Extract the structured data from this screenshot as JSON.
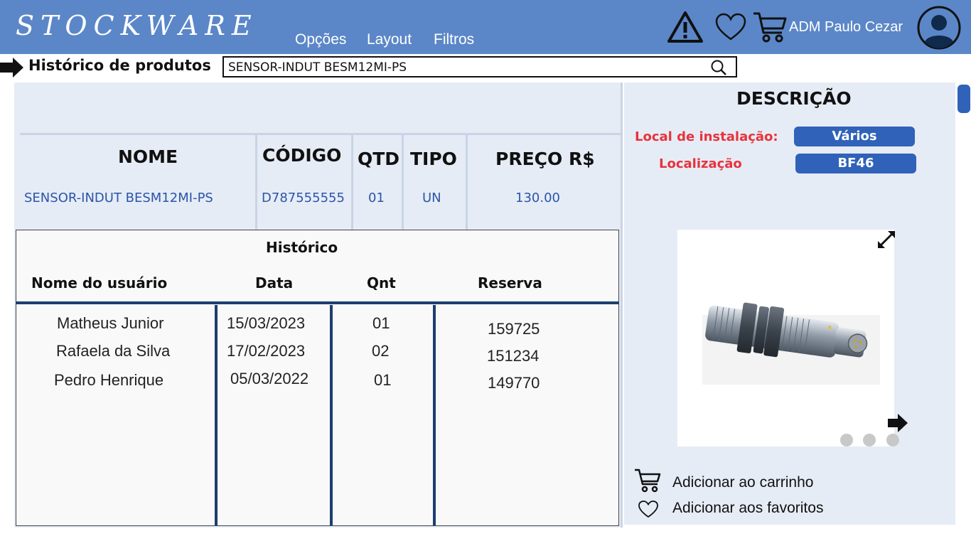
{
  "header": {
    "brand": "STOCKWARE",
    "nav": [
      "Opções",
      "Layout",
      "Filtros"
    ],
    "user_name": "ADM Paulo Cezar",
    "icons": [
      "warning-icon",
      "heart-icon",
      "cart-icon",
      "user-avatar-icon"
    ]
  },
  "search": {
    "label": "Histórico de produtos",
    "value": "SENSOR-INDUT BESM12MI-PS"
  },
  "product": {
    "columns": {
      "nome": "NOME",
      "codigo": "CÓDIGO",
      "qtd": "QTD",
      "tipo": "TIPO",
      "preco": "PREÇO R$"
    },
    "row": {
      "nome": "SENSOR-INDUT BESM12MI-PS",
      "codigo": "D787555555",
      "qtd": "01",
      "tipo": "UN",
      "preco": "130.00"
    }
  },
  "history": {
    "title": "Histórico",
    "columns": {
      "usuario": "Nome do usuário",
      "data": "Data",
      "qnt": "Qnt",
      "reserva": "Reserva"
    },
    "rows": [
      {
        "usuario": "Matheus Junior",
        "data": "15/03/2023",
        "qnt": "01",
        "reserva": "159725"
      },
      {
        "usuario": "Rafaela da Silva",
        "data": "17/02/2023",
        "qnt": "02",
        "reserva": "151234"
      },
      {
        "usuario": "Pedro Henrique",
        "data": "05/03/2022",
        "qnt": "01",
        "reserva": "149770"
      }
    ]
  },
  "description": {
    "title": "DESCRIÇÃO",
    "install_label": "Local de instalação:",
    "install_value": "Vários",
    "location_label": "Localização",
    "location_value": "BF46",
    "add_cart": "Adicionar ao carrinho",
    "add_favorites": "Adicionar aos favoritos"
  },
  "colors": {
    "header": "#5b87c8",
    "panel": "#e6ecf6",
    "accent": "#2f62b8",
    "label_red": "#e8333b",
    "history_lines": "#1c3f6e"
  }
}
